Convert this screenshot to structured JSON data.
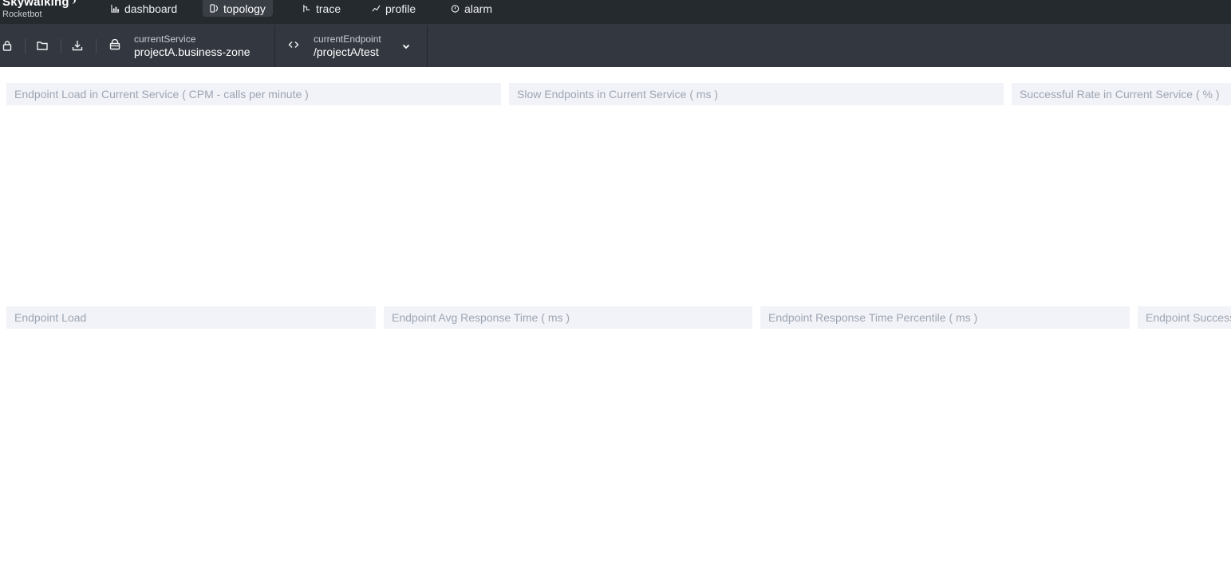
{
  "brand": {
    "name": "Skywalking",
    "subtitle": "Rocketbot"
  },
  "nav": {
    "tabs": [
      {
        "label": "dashboard",
        "icon": "dashboard-icon"
      },
      {
        "label": "topology",
        "icon": "topology-icon",
        "active": true
      },
      {
        "label": "trace",
        "icon": "trace-icon"
      },
      {
        "label": "profile",
        "icon": "profile-icon"
      },
      {
        "label": "alarm",
        "icon": "alarm-icon"
      }
    ]
  },
  "toolbar": {
    "icons": [
      "lock-icon",
      "folder-icon",
      "download-icon"
    ],
    "service": {
      "label": "currentService",
      "value": "projectA.business-zone",
      "icon": "service-icon"
    },
    "endpoint": {
      "label": "currentEndpoint",
      "value": "/projectA/test",
      "icon": "code-icon"
    }
  },
  "panels": {
    "row1": [
      {
        "title": "Endpoint Load in Current Service ( CPM - calls per minute )"
      },
      {
        "title": "Slow Endpoints in Current Service ( ms )"
      },
      {
        "title": "Successful Rate in Current Service ( % )"
      }
    ],
    "row2": [
      {
        "title": "Endpoint Load"
      },
      {
        "title": "Endpoint Avg Response Time ( ms )"
      },
      {
        "title": "Endpoint Response Time Percentile ( ms )"
      },
      {
        "title": "Endpoint Successful Rate ( % )"
      }
    ]
  },
  "colors": {
    "nav_bg": "#252a2f",
    "toolbar_bg": "#333840",
    "panel_header_bg": "#f2f3f8",
    "panel_header_text": "#9da5b2"
  }
}
